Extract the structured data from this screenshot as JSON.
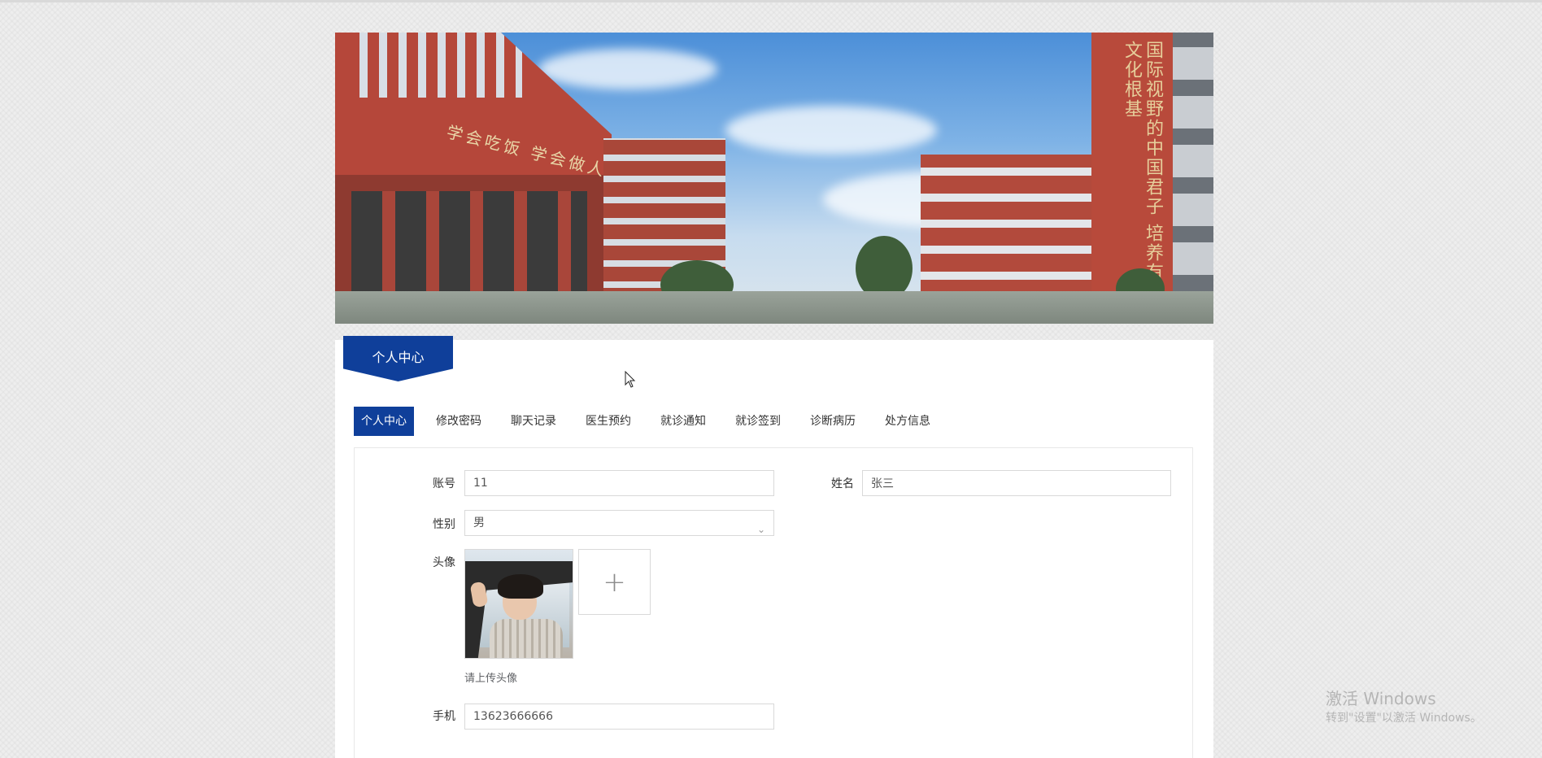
{
  "banner": {
    "sign_left": "学会吃饭 学会做人",
    "sign_tower": "国际视野的中国君子 培养有民族文化根基"
  },
  "section": {
    "title": "个人中心"
  },
  "tabs": [
    {
      "label": "个人中心",
      "active": true
    },
    {
      "label": "修改密码",
      "active": false
    },
    {
      "label": "聊天记录",
      "active": false
    },
    {
      "label": "医生预约",
      "active": false
    },
    {
      "label": "就诊通知",
      "active": false
    },
    {
      "label": "就诊签到",
      "active": false
    },
    {
      "label": "诊断病历",
      "active": false
    },
    {
      "label": "处方信息",
      "active": false
    }
  ],
  "form": {
    "account": {
      "label": "账号",
      "value": "11"
    },
    "name": {
      "label": "姓名",
      "value": "张三"
    },
    "gender": {
      "label": "性别",
      "value": "男"
    },
    "avatar": {
      "label": "头像",
      "hint": "请上传头像",
      "add_icon": "plus-icon"
    },
    "phone": {
      "label": "手机",
      "value": "13623666666"
    }
  },
  "watermark": {
    "line1": "激活 Windows",
    "line2": "转到\"设置\"以激活 Windows。"
  },
  "colors": {
    "primary": "#0f3f9a",
    "border": "#d9d9d9"
  }
}
